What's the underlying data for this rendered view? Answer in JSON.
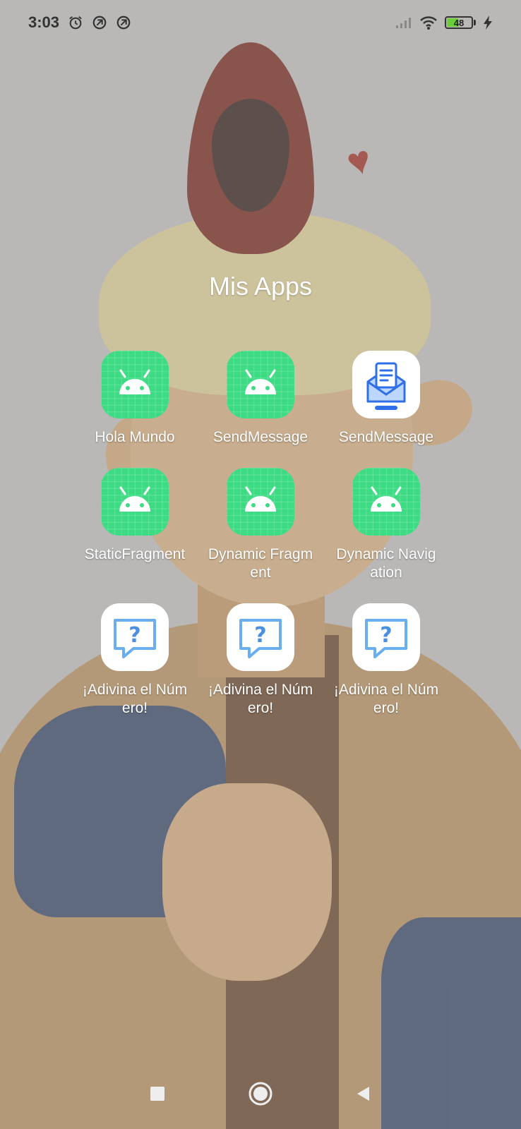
{
  "status_bar": {
    "time": "3:03",
    "icons": [
      "alarm-icon",
      "sync-icon",
      "sync-icon"
    ],
    "battery_level": "48",
    "battery_color": "#6ccf3a"
  },
  "folder": {
    "title": "Mis Apps",
    "apps": [
      {
        "label": "Hola Mundo",
        "icon": "android-icon"
      },
      {
        "label": "SendMessage",
        "icon": "android-icon"
      },
      {
        "label": "SendMessage",
        "icon": "message-icon"
      },
      {
        "label": "StaticFragment",
        "icon": "android-icon"
      },
      {
        "label": "Dynamic Fragment",
        "icon": "android-icon"
      },
      {
        "label": "Dynamic Navigation",
        "icon": "android-icon"
      },
      {
        "label": "¡Adivina el Número!",
        "icon": "question-chat-icon"
      },
      {
        "label": "¡Adivina el Número!",
        "icon": "question-chat-icon"
      },
      {
        "label": "¡Adivina el Número!",
        "icon": "question-chat-icon"
      }
    ]
  },
  "nav_bar": {
    "buttons": [
      "recents-button",
      "home-button",
      "back-button"
    ]
  },
  "colors": {
    "android_green": "#3ddc84",
    "message_blue": "#2f6fe8",
    "question_blue": "#6aaef2"
  }
}
